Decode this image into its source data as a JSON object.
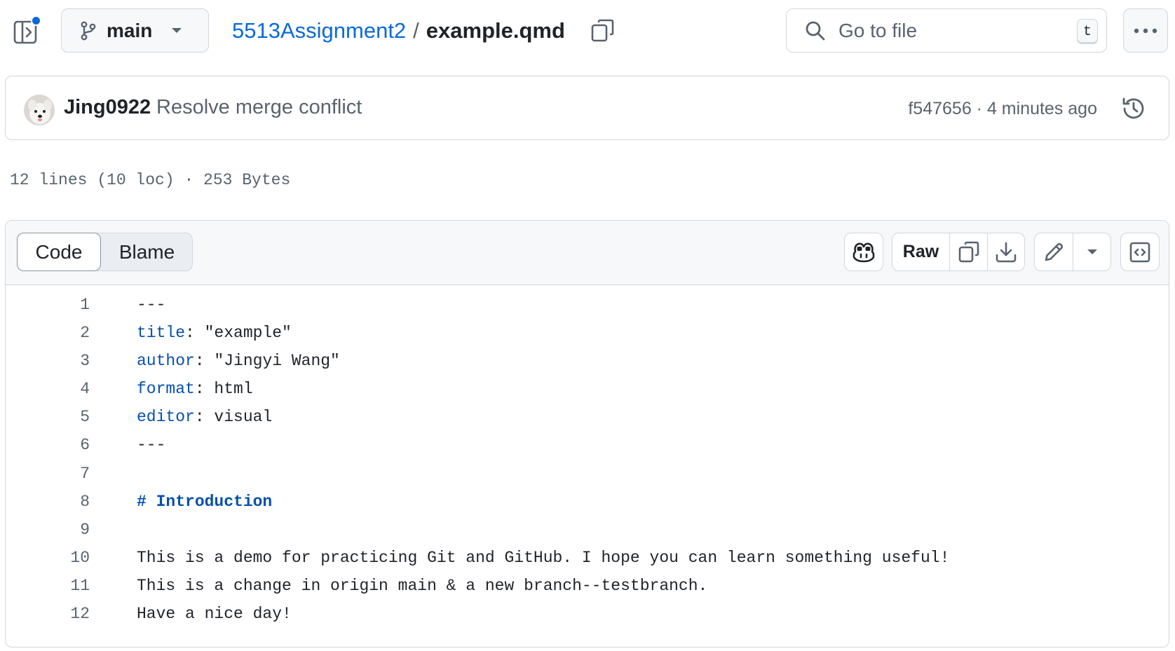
{
  "header": {
    "branch": "main",
    "repo": "5513Assignment2",
    "separator": "/",
    "file": "example.qmd",
    "search_placeholder": "Go to file",
    "search_shortcut": "t"
  },
  "commit": {
    "author": "Jing0922",
    "message": "Resolve merge conflict",
    "meta": "f547656 · 4 minutes ago"
  },
  "file_info": "12 lines (10 loc) · 253 Bytes",
  "viewer": {
    "tabs": [
      "Code",
      "Blame"
    ],
    "raw_label": "Raw"
  },
  "code_lines": [
    {
      "n": "1",
      "key": "",
      "rest": "---",
      "heading": ""
    },
    {
      "n": "2",
      "key": "title",
      "rest": ": \"example\"",
      "heading": ""
    },
    {
      "n": "3",
      "key": "author",
      "rest": ": \"Jingyi Wang\"",
      "heading": ""
    },
    {
      "n": "4",
      "key": "format",
      "rest": ": html",
      "heading": ""
    },
    {
      "n": "5",
      "key": "editor",
      "rest": ": visual",
      "heading": ""
    },
    {
      "n": "6",
      "key": "",
      "rest": "---",
      "heading": ""
    },
    {
      "n": "7",
      "key": "",
      "rest": "",
      "heading": ""
    },
    {
      "n": "8",
      "key": "",
      "rest": "",
      "heading": "# Introduction"
    },
    {
      "n": "9",
      "key": "",
      "rest": "",
      "heading": ""
    },
    {
      "n": "10",
      "key": "",
      "rest": "This is a demo for practicing Git and GitHub. I hope you can learn something useful!",
      "heading": ""
    },
    {
      "n": "11",
      "key": "",
      "rest": "This is a change in origin main & a new branch--testbranch.",
      "heading": ""
    },
    {
      "n": "12",
      "key": "",
      "rest": "Have a nice day!",
      "heading": ""
    }
  ],
  "colors": {
    "link": "#0969da",
    "yaml_key": "#0550ae",
    "muted": "#59636e",
    "border": "#d0d7de"
  }
}
